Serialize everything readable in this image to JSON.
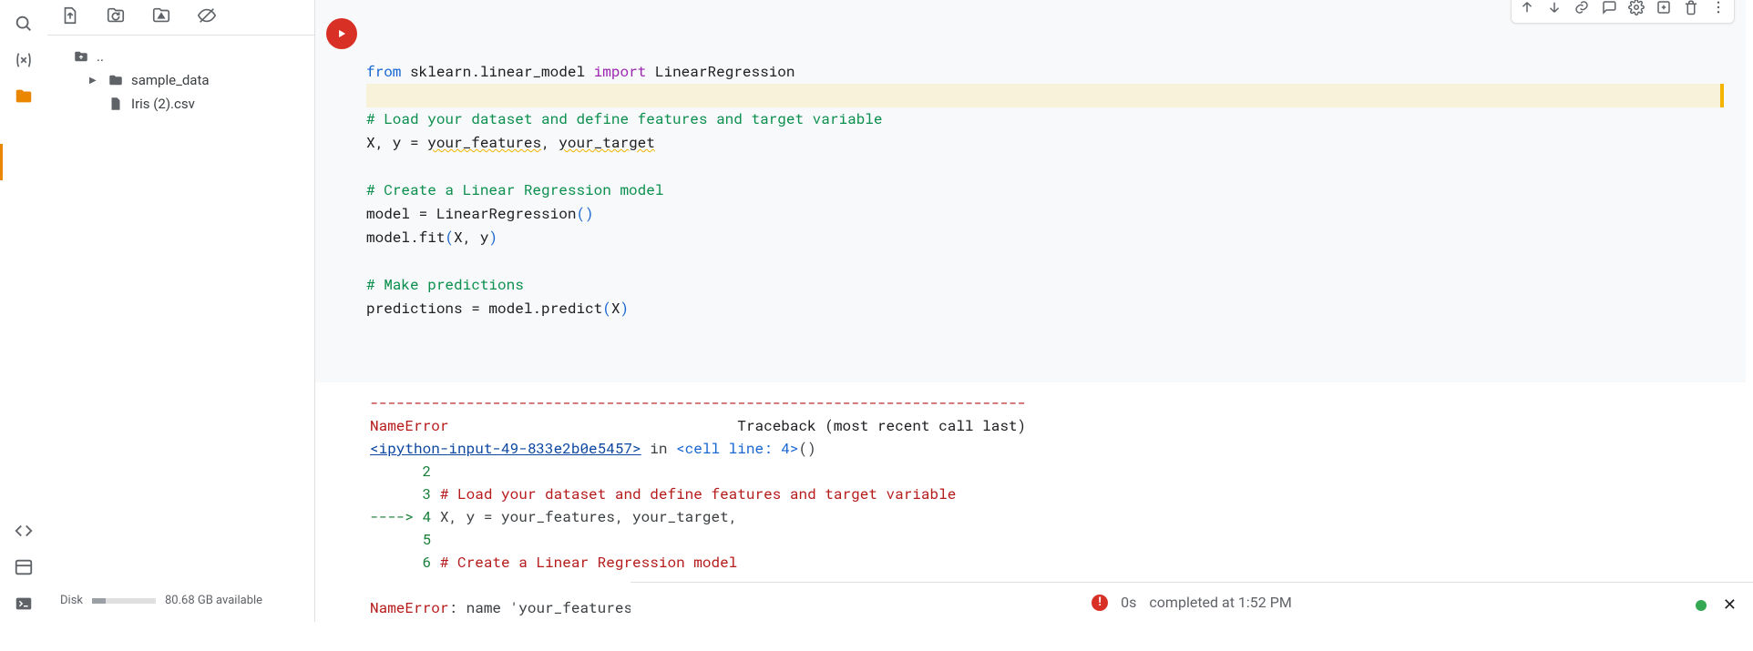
{
  "file_toolbar": {},
  "file_tree": {
    "up": "..",
    "items": [
      {
        "name": "sample_data"
      },
      {
        "name": "Iris (2).csv"
      }
    ]
  },
  "disk": {
    "label": "Disk",
    "available": "80.68 GB available"
  },
  "code": {
    "kw_from": "from",
    "mod": "sklearn.linear_model",
    "kw_import": "import",
    "cls": "LinearRegression",
    "c1": "# Load your dataset and define features and target variable",
    "l3_a": "X, y = ",
    "l3_b": "your_features",
    "l3_c": ", ",
    "l3_d": "your_target",
    "c2": "# Create a Linear Regression model",
    "l5_a": "model = LinearRegression",
    "l5_b": "()",
    "l6_a": "model.fit",
    "l6_b": "(",
    "l6_c": "X, y",
    "l6_d": ")",
    "c3": "# Make predictions",
    "l8_a": "predictions = model.predict",
    "l8_b": "(",
    "l8_c": "X",
    "l8_d": ")"
  },
  "output": {
    "dashes": "---------------------------------------------------------------------------",
    "err_name": "NameError",
    "tb_label": "Traceback (most recent call last)",
    "link": "<ipython-input-49-833e2b0e5457>",
    "in_text": " in ",
    "cell_ref": "<cell line: 4>",
    "pn": "()",
    "ln2": "      2",
    "ln3": "      3",
    "src3": " # Load your dataset and define features and target variable",
    "arrow4": "----> 4",
    "src4": " X, y = your_features, your_target,",
    "ln5": "      5",
    "ln6": "      6",
    "src6": " # Create a Linear Regression model",
    "final_pre": "NameError",
    "final_post": ": name 'your_features' is not defined"
  },
  "status": {
    "duration": "0s",
    "completed": "completed at 1:52 PM"
  }
}
